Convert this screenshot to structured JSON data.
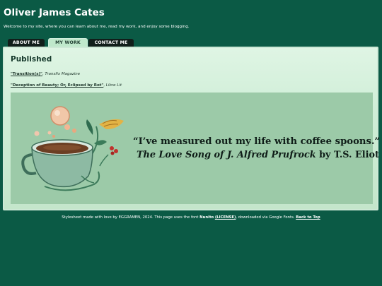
{
  "site": {
    "title": "Oliver James Cates",
    "tagline": "Welcome to my site, where you can learn about me, read my work, and enjoy some blogging."
  },
  "tabs": [
    {
      "label": "ABOUT ME",
      "active": false
    },
    {
      "label": "MY WORK",
      "active": true
    },
    {
      "label": "CONTACT ME",
      "active": false
    }
  ],
  "main": {
    "heading": "Published",
    "works": [
      {
        "title": "\"Transition(s)\"",
        "separator": ",",
        "publication": "Transfix Magazine"
      },
      {
        "title": "\"Deception of Beauty; Or, Eclipsed by Rot\"",
        "separator": ",",
        "publication": "Libre Lit"
      }
    ],
    "banner": {
      "quote": "“I’ve measured out my life with coffee spoons.”",
      "source_title": "The Love Song of J. Alfred Prufrock",
      "source_by": "by T.S. Eliot",
      "illustration": "coffee-cup-illustration"
    }
  },
  "footer": {
    "text_before": "Stylesheet made with love by EGGRAMEN, 2024. This page uses the font ",
    "font_name": "Nunito",
    "license_link": "(LICENSE)",
    "text_middle": ", downloaded via Google Fonts. ",
    "top_link": "Back to Top"
  },
  "colors": {
    "background": "#0b5a45",
    "panel": "#cfeed7",
    "banner": "#9ccaa8",
    "tab_inactive": "#111e1a",
    "tab_active": "#bfe8cb"
  }
}
